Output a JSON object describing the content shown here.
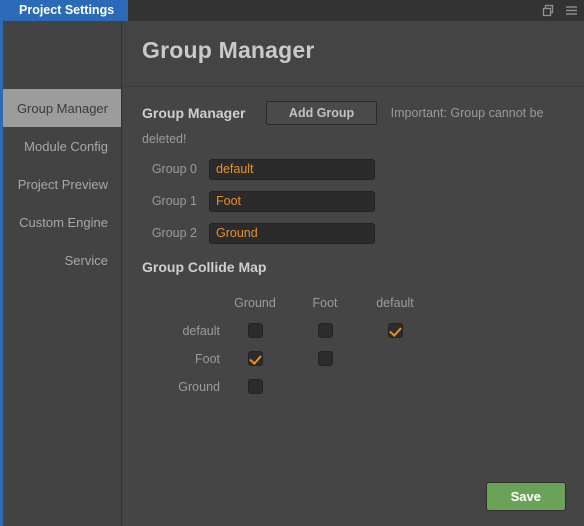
{
  "window": {
    "tab_label": "Project Settings",
    "icons": [
      {
        "name": "restore-window-icon",
        "glyph": "restore"
      },
      {
        "name": "menu-icon",
        "glyph": "hamburger"
      }
    ]
  },
  "sidebar": {
    "items": [
      {
        "label": "Group Manager",
        "active": true
      },
      {
        "label": "Module Config",
        "active": false
      },
      {
        "label": "Project Preview",
        "active": false
      },
      {
        "label": "Custom Engine",
        "active": false
      },
      {
        "label": "Service",
        "active": false
      }
    ]
  },
  "page": {
    "title": "Group Manager"
  },
  "group_manager": {
    "section_title": "Group Manager",
    "add_button": "Add Group",
    "note": "Important: Group cannot be deleted!",
    "groups": [
      {
        "label": "Group 0",
        "value": "default"
      },
      {
        "label": "Group 1",
        "value": "Foot"
      },
      {
        "label": "Group 2",
        "value": "Ground"
      }
    ]
  },
  "collide_map": {
    "section_title": "Group Collide Map",
    "columns": [
      "Ground",
      "Foot",
      "default"
    ],
    "rows": [
      {
        "label": "default",
        "cells": [
          {
            "present": true,
            "checked": false
          },
          {
            "present": true,
            "checked": false
          },
          {
            "present": true,
            "checked": true
          }
        ]
      },
      {
        "label": "Foot",
        "cells": [
          {
            "present": true,
            "checked": true
          },
          {
            "present": true,
            "checked": false
          },
          {
            "present": false,
            "checked": false
          }
        ]
      },
      {
        "label": "Ground",
        "cells": [
          {
            "present": true,
            "checked": false
          },
          {
            "present": false,
            "checked": false
          },
          {
            "present": false,
            "checked": false
          }
        ]
      }
    ]
  },
  "footer": {
    "save_label": "Save"
  },
  "colors": {
    "accent_blue": "#2a6ab9",
    "checkbox_orange": "#ef8f24",
    "input_text_orange": "#e8912a",
    "save_green": "#6aa357",
    "background": "#434343"
  }
}
